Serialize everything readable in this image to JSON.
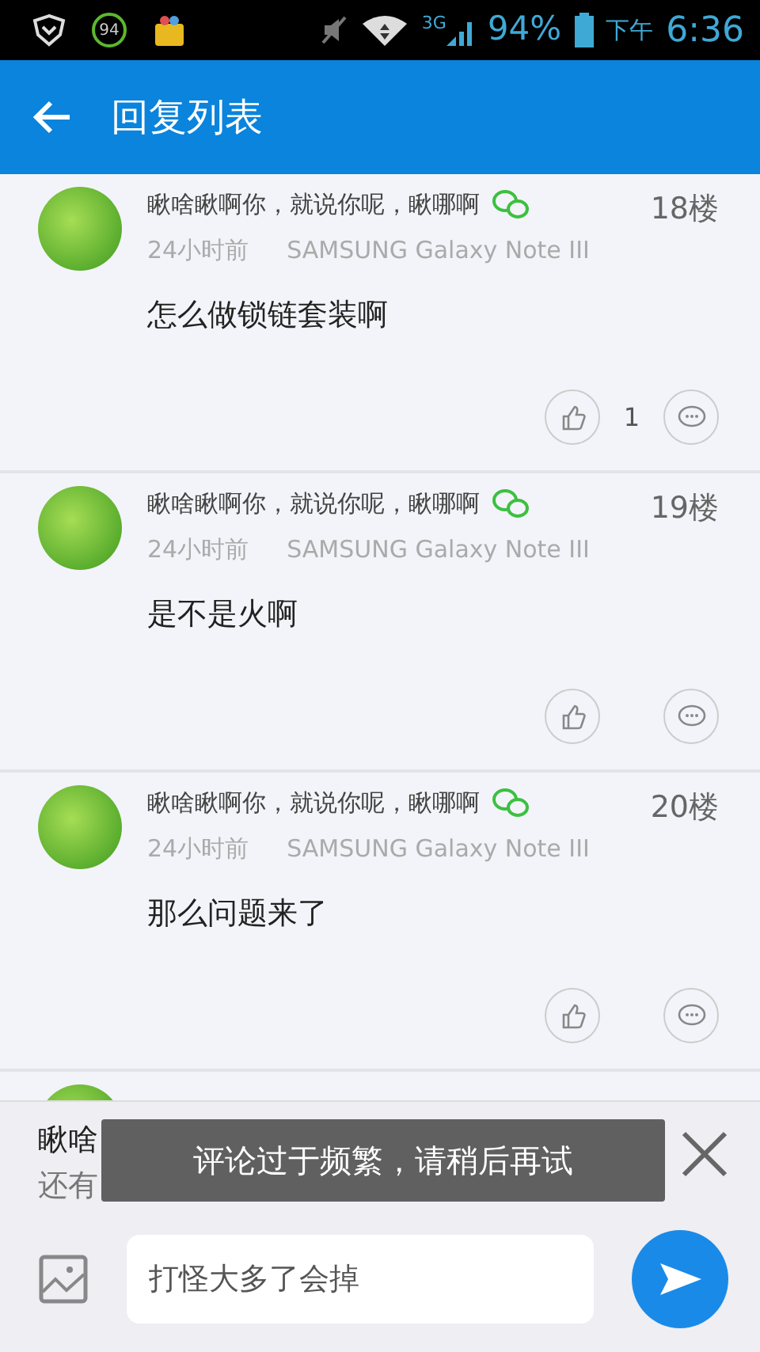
{
  "status_bar": {
    "notification_badge": "94",
    "network": "3G",
    "battery": "94%",
    "period": "下午",
    "time": "6:36"
  },
  "app_bar": {
    "title": "回复列表"
  },
  "comments": [
    {
      "name": "瞅啥瞅啊你，就说你呢，瞅哪啊",
      "time": "24小时前",
      "device": "SAMSUNG Galaxy Note III",
      "floor": "18楼",
      "content": "怎么做锁链套装啊",
      "likes": "1"
    },
    {
      "name": "瞅啥瞅啊你，就说你呢，瞅哪啊",
      "time": "24小时前",
      "device": "SAMSUNG Galaxy Note III",
      "floor": "19楼",
      "content": "是不是火啊"
    },
    {
      "name": "瞅啥瞅啊你，就说你呢，瞅哪啊",
      "time": "24小时前",
      "device": "SAMSUNG Galaxy Note III",
      "floor": "20楼",
      "content": "那么问题来了"
    }
  ],
  "reply_panel": {
    "quote_name": "瞅啥",
    "quote_text": "还有",
    "input_value": "打怪大多了会掉"
  },
  "toast": {
    "text": "评论过于频繁，请稍后再试"
  }
}
